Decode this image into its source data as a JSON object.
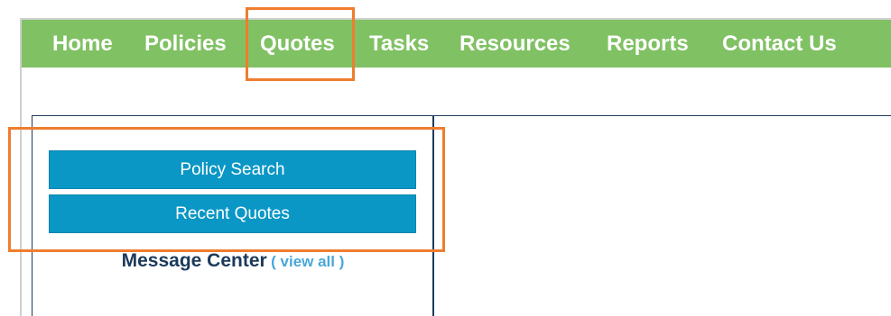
{
  "nav": {
    "items": [
      {
        "label": "Home"
      },
      {
        "label": "Policies"
      },
      {
        "label": "Quotes"
      },
      {
        "label": "Tasks"
      },
      {
        "label": "Resources"
      },
      {
        "label": "Reports"
      },
      {
        "label": "Contact Us"
      }
    ],
    "active": "Quotes"
  },
  "sidebar": {
    "buttons": [
      {
        "label": "Policy Search"
      },
      {
        "label": "Recent Quotes"
      }
    ]
  },
  "message_center": {
    "title": "Message Center",
    "view_all": "( view all )"
  },
  "colors": {
    "nav_bg": "#80c164",
    "button_bg": "#0a97c5",
    "highlight": "#ef7d2f",
    "title_text": "#1b3a5c",
    "link_text": "#4aa7d8"
  }
}
